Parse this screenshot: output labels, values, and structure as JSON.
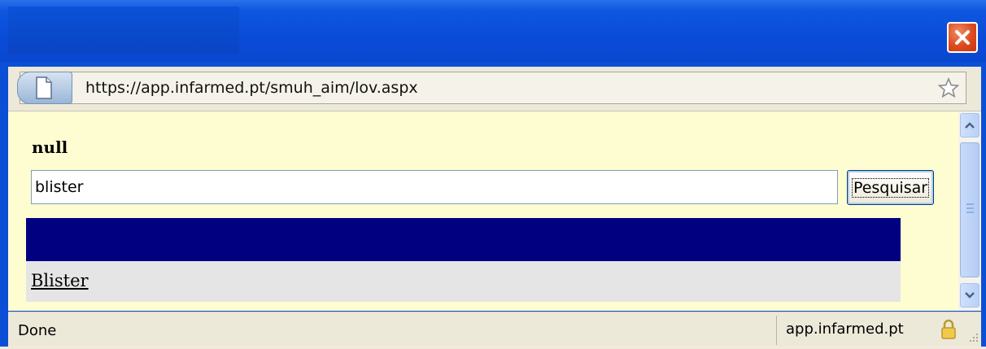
{
  "browser": {
    "url": "https://app.infarmed.pt/smuh_aim/lov.aspx",
    "status": "Done",
    "status_domain": "app.infarmed.pt"
  },
  "page": {
    "title": "null",
    "search_value": "blister",
    "search_button_label": "Pesquisar",
    "results": [
      {
        "label": "Blister"
      }
    ]
  },
  "icons": {
    "close": "close-icon",
    "page": "page-icon",
    "star": "star-icon",
    "lock": "lock-icon",
    "scroll_up": "chevron-up-icon",
    "scroll_down": "chevron-down-icon"
  },
  "colors": {
    "title_bar": "#0a4fd6",
    "close_button": "#dd4a1e",
    "page_background": "#fefdd2",
    "result_header": "#000080",
    "result_row": "#e5e5e5"
  }
}
